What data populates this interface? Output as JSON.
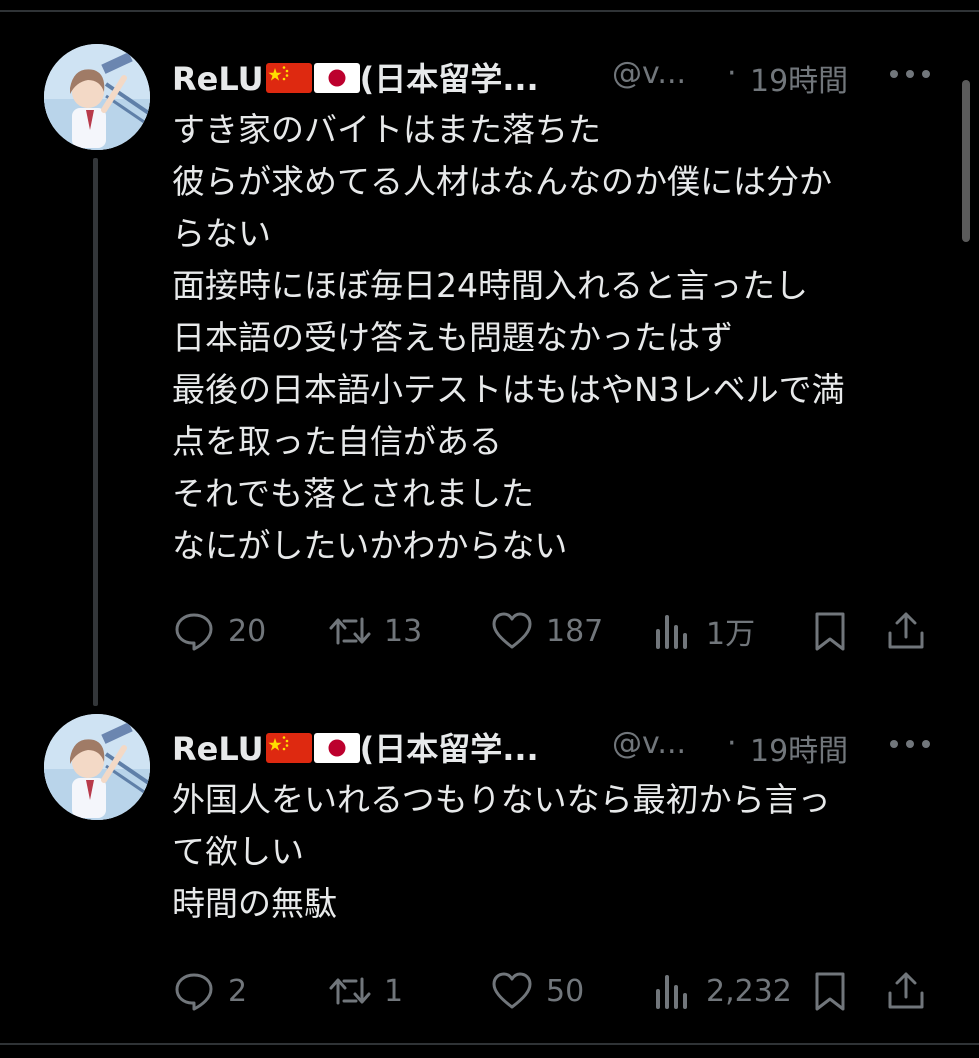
{
  "tweets": [
    {
      "author_name": "ReLU",
      "author_suffix": "(日本留学...",
      "handle": "@v...",
      "separator": "·",
      "time": "19時間",
      "lines": [
        "すき家のバイトはまた落ちた",
        "彼らが求めてる人材はなんなのか僕には分か",
        "らない",
        "面接時にほぼ毎日24時間入れると言ったし",
        "日本語の受け答えも問題なかったはず",
        "最後の日本語小テストはもはやN3レベルで満",
        "点を取った自信がある",
        "それでも落とされました",
        "なにがしたいかわからない"
      ],
      "replies": "20",
      "retweets": "13",
      "likes": "187",
      "views": "1万"
    },
    {
      "author_name": "ReLU",
      "author_suffix": "(日本留学...",
      "handle": "@v...",
      "separator": "·",
      "time": "19時間",
      "lines": [
        "外国人をいれるつもりないなら最初から言っ",
        "て欲しい",
        "時間の無駄"
      ],
      "replies": "2",
      "retweets": "1",
      "likes": "50",
      "views": "2,232"
    }
  ],
  "icons": {
    "flag_1": "china-flag-icon",
    "flag_2": "japan-flag-icon",
    "more": "more-icon",
    "reply": "reply-icon",
    "retweet": "retweet-icon",
    "like": "heart-icon",
    "views": "views-icon",
    "bookmark": "bookmark-icon",
    "share": "share-icon"
  },
  "colors": {
    "background": "#000000",
    "text": "#e7e9ea",
    "secondary": "#71767b",
    "divider": "#2f3336"
  }
}
